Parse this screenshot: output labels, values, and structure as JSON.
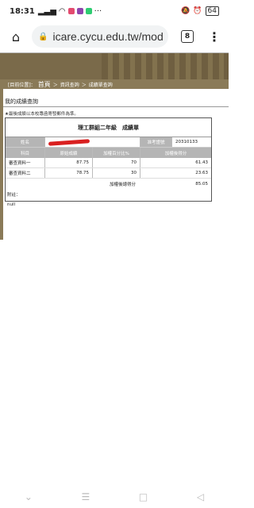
{
  "status": {
    "time": "18:31",
    "battery": "64"
  },
  "browser": {
    "url": "icare.cycu.edu.tw/mod",
    "tab_count": "8"
  },
  "breadcrumb": {
    "label": "[目前位置]：",
    "home": "首頁",
    "sep1": "＞",
    "section": "資訊查詢",
    "sep2": "＞",
    "page": "成績單查詢"
  },
  "page": {
    "title": "我的成績查詢",
    "note": "★最後成績以本校專函寄發郵件為準。"
  },
  "grade": {
    "header": "理工群組二年級　成績單",
    "name_label": "姓名",
    "exam_no_label": "准考證號",
    "exam_no": "20310133",
    "columns": [
      "科目",
      "原始成績",
      "加權百分比%",
      "加權後得分"
    ],
    "rows": [
      {
        "subject": "審查資料一",
        "raw": "87.75",
        "pct": "70",
        "weighted": "61.43"
      },
      {
        "subject": "審查資料二",
        "raw": "78.75",
        "pct": "30",
        "weighted": "23.63"
      }
    ],
    "total_label": "加權後總得分",
    "total": "85.05",
    "remark_label": "附註：",
    "remark": "null"
  }
}
